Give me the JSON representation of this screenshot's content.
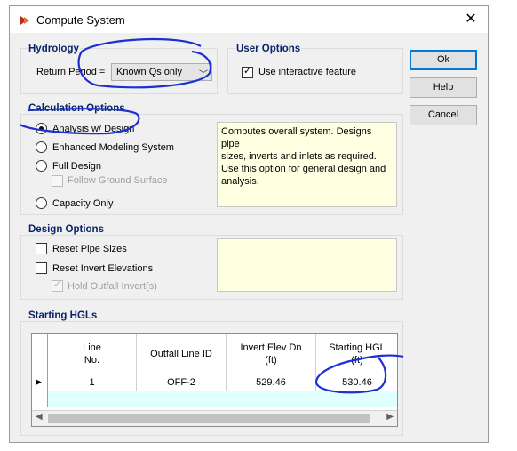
{
  "window": {
    "title": "Compute System",
    "app_icon": "app-icon",
    "close_icon": "close-icon"
  },
  "hydrology": {
    "title": "Hydrology",
    "return_period_label": "Return Period =",
    "return_period_value": "Known Qs only"
  },
  "user_options": {
    "title": "User Options",
    "interactive_label": "Use interactive feature",
    "interactive_checked": true
  },
  "buttons": {
    "ok": "Ok",
    "help": "Help",
    "cancel": "Cancel"
  },
  "calculation_options": {
    "title": "Calculation Options",
    "options": [
      {
        "label": "Analysis w/ Design",
        "selected": true
      },
      {
        "label": "Enhanced Modeling System",
        "selected": false
      },
      {
        "label": "Full Design",
        "selected": false
      },
      {
        "label": "Capacity Only",
        "selected": false
      }
    ],
    "follow_ground_label": "Follow Ground Surface",
    "description": "Computes overall system. Designs pipe\nsizes, inverts and inlets as required.\nUse this option for general design and\nanalysis."
  },
  "design_options": {
    "title": "Design Options",
    "reset_pipe_sizes": "Reset Pipe Sizes",
    "reset_invert_elevations": "Reset Invert Elevations",
    "hold_outfall_invert": "Hold Outfall Invert(s)",
    "hold_outfall_checked": true
  },
  "starting_hgls": {
    "title": "Starting HGLs",
    "columns": [
      "Line\nNo.",
      "Outfall Line ID",
      "Invert Elev Dn\n(ft)",
      "Starting HGL\n(ft)"
    ],
    "rows": [
      [
        "1",
        "OFF-2",
        "529.46",
        "530.46"
      ]
    ]
  },
  "colors": {
    "group_title": "#0a246a",
    "description_bg": "#ffffe1",
    "selected_row_bg": "#e0ffff",
    "annotation_ink": "#1d2fd1"
  }
}
